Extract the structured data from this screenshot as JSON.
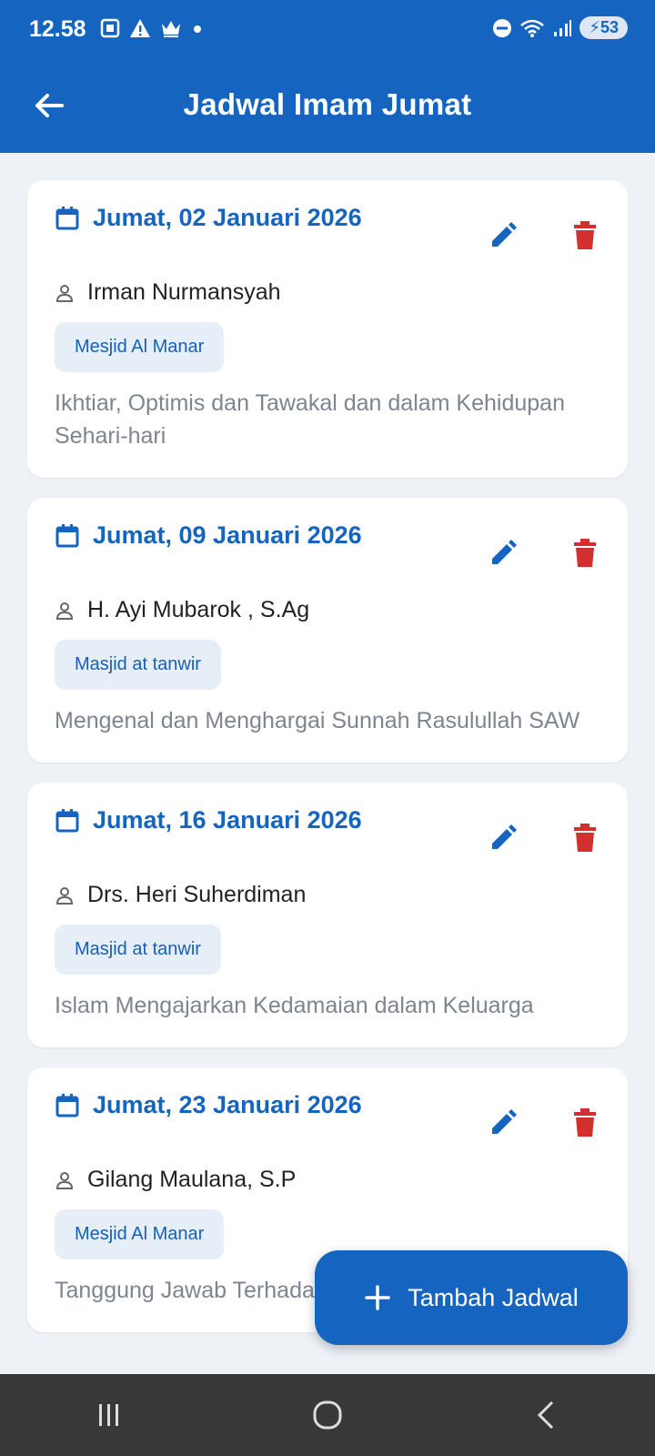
{
  "status_bar": {
    "time": "12.58",
    "battery": "53",
    "left_icons": [
      "screenshot-icon",
      "warning-icon",
      "crown-icon",
      "dot-icon"
    ],
    "right_icons": [
      "dnd-icon",
      "wifi-icon",
      "signal-icon",
      "battery-icon"
    ]
  },
  "app_bar": {
    "title": "Jadwal Imam Jumat"
  },
  "schedules": [
    {
      "date": "Jumat, 02 Januari 2026",
      "imam": "Irman Nurmansyah",
      "mosque": "Mesjid Al Manar",
      "topic": "Ikhtiar, Optimis dan Tawakal dan dalam Kehidupan Sehari-hari"
    },
    {
      "date": "Jumat, 09 Januari 2026",
      "imam": "H. Ayi Mubarok , S.Ag",
      "mosque": "Masjid at tanwir",
      "topic": "Mengenal dan Menghargai Sunnah Rasulullah SAW"
    },
    {
      "date": "Jumat, 16 Januari 2026",
      "imam": "Drs. Heri Suherdiman",
      "mosque": "Masjid at tanwir",
      "topic": "Islam Mengajarkan Kedamaian dalam Keluarga"
    },
    {
      "date": "Jumat, 23 Januari 2026",
      "imam": "Gilang Maulana, S.P",
      "mosque": "Mesjid Al Manar",
      "topic": "Tanggung Jawab Terhadap Keluarga dalam Islam"
    }
  ],
  "fab": {
    "label": "Tambah Jadwal"
  },
  "colors": {
    "primary": "#1565c0",
    "delete": "#d32f2f",
    "background": "#eef2f7",
    "chip_bg": "#e6eef8",
    "topic_text": "#7d8590"
  }
}
